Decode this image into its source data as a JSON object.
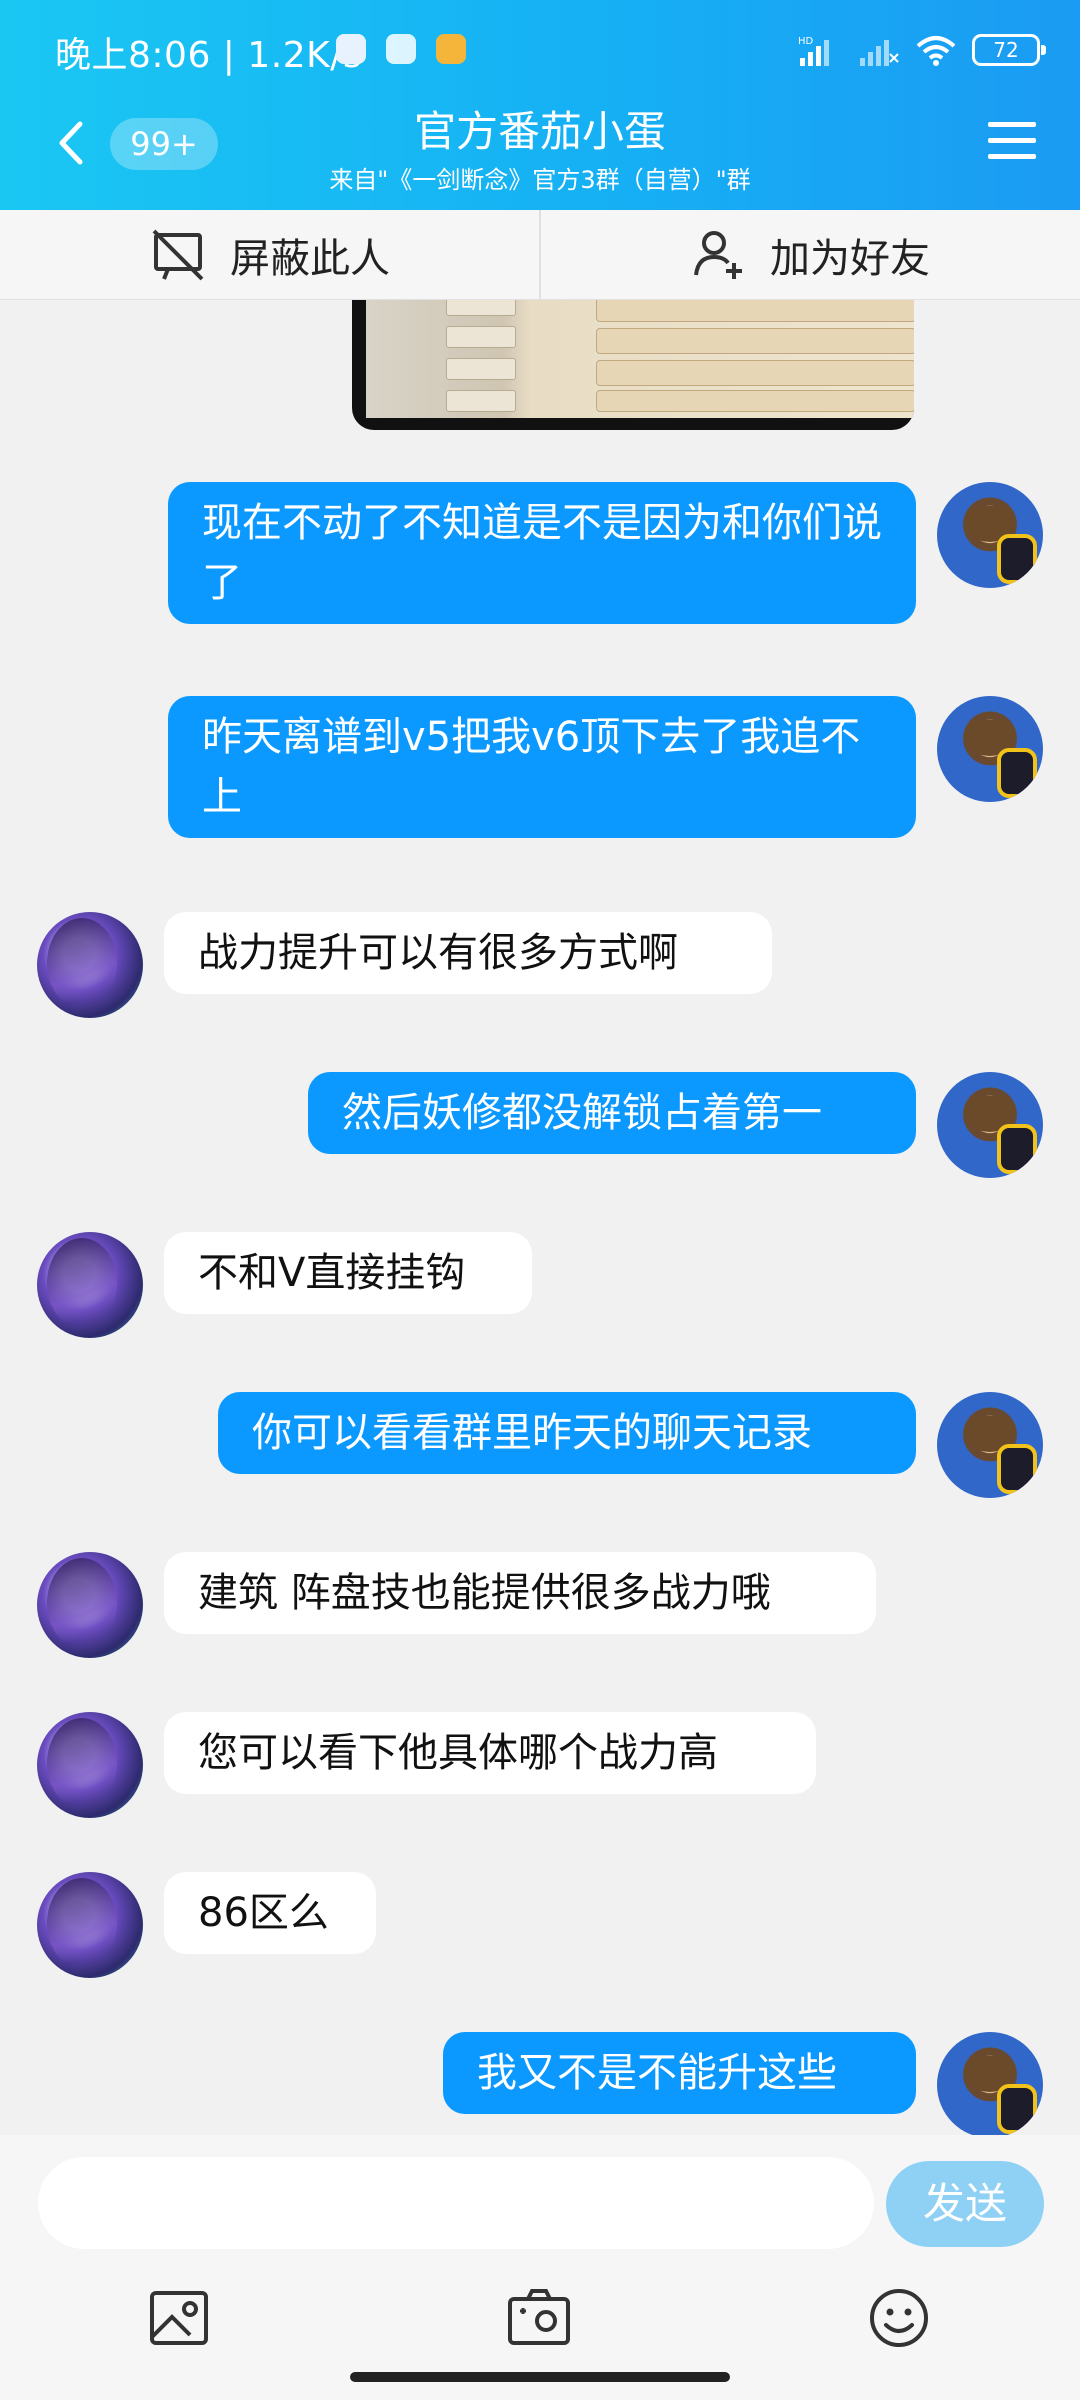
{
  "status_bar": {
    "time": "晚上8:06 | 1.2K/s",
    "battery": "72"
  },
  "header": {
    "badge": "99+",
    "title": "官方番茄小蛋",
    "subtitle": "来自\"《一剑断念》官方3群（自营）\"群"
  },
  "actions": {
    "block_label": "屏蔽此人",
    "add_friend_label": "加为好友"
  },
  "messages": [
    {
      "from": "me",
      "text": "现在不动了不知道是不是因为和你们说了"
    },
    {
      "from": "me",
      "text": "昨天离谱到v5把我v6顶下去了我追不上"
    },
    {
      "from": "them",
      "text": "战力提升可以有很多方式啊"
    },
    {
      "from": "me",
      "text": "然后妖修都没解锁占着第一"
    },
    {
      "from": "them",
      "text": "不和V直接挂钩"
    },
    {
      "from": "me",
      "text": "你可以看看群里昨天的聊天记录"
    },
    {
      "from": "them",
      "text": "建筑 阵盘技也能提供很多战力哦"
    },
    {
      "from": "them",
      "text": "您可以看下他具体哪个战力高"
    },
    {
      "from": "them",
      "text": "86区么"
    },
    {
      "from": "me",
      "text": "我又不是不能升这些"
    }
  ],
  "composer": {
    "send_label": "发送",
    "placeholder": ""
  },
  "icons": [
    "back-arrow-icon",
    "menu-icon",
    "block-icon",
    "add-friend-icon",
    "image-icon",
    "camera-icon",
    "emoji-icon"
  ]
}
